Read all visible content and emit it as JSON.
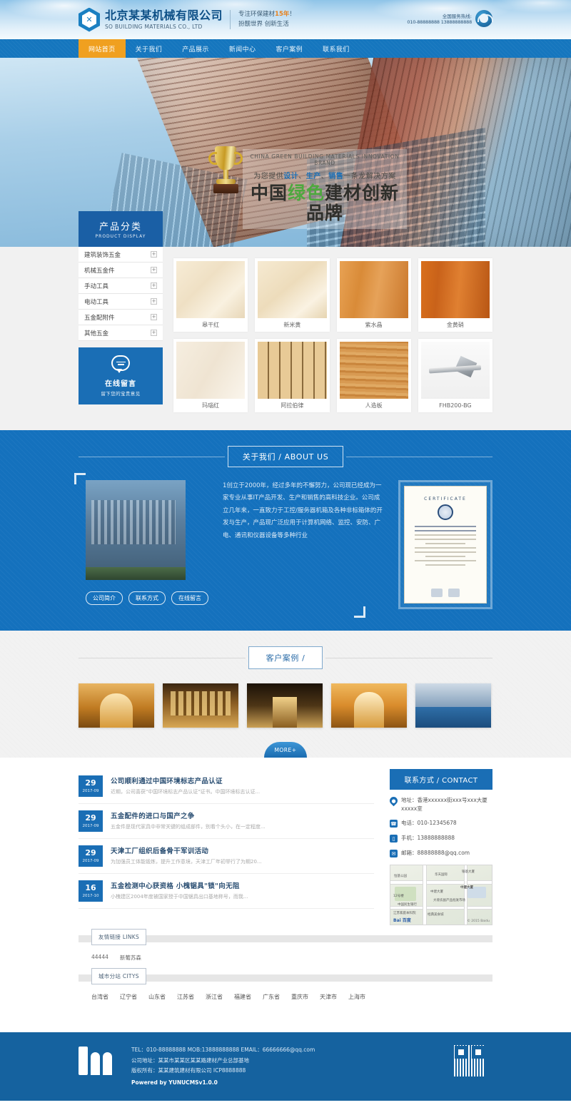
{
  "header": {
    "logo_cn": "北京某某机械有限公司",
    "logo_en": "SO BUILDING MATERIALS CO., LTD",
    "logo_glyph": "✕",
    "slogan_line1_pre": "专注环保建材",
    "slogan_line1_hl": "15年",
    "slogan_line1_post": "！",
    "slogan_line2": "扮靓世界 创新生活",
    "hotline_label": "全国服务热线:",
    "hotline_number": "010-88888888 13888888888"
  },
  "nav": {
    "items": [
      {
        "label": "网站首页",
        "active": true
      },
      {
        "label": "关于我们",
        "active": false
      },
      {
        "label": "产品展示",
        "active": false
      },
      {
        "label": "新闻中心",
        "active": false
      },
      {
        "label": "客户案例",
        "active": false
      },
      {
        "label": "联系我们",
        "active": false
      }
    ]
  },
  "banner": {
    "english": "CHINA GREEN BUILDING MATERIALS INNOVATION BRAND",
    "subtitle_a": "为您提供",
    "subtitle_b": "设计",
    "subtitle_c": "、",
    "subtitle_d": "生产",
    "subtitle_e": "、",
    "subtitle_f": "销售",
    "subtitle_g": "一条龙解决方案",
    "title_pre": "中国",
    "title_green": "绿色",
    "title_post": "建材创新品牌"
  },
  "products": {
    "panel_title_cn": "产品分类",
    "panel_title_en": "PRODUCT DISPLAY",
    "categories": [
      {
        "label": "建筑装饰五金",
        "expand": "+"
      },
      {
        "label": "机械五金件",
        "expand": "+"
      },
      {
        "label": "手动工具",
        "expand": "+"
      },
      {
        "label": "电动工具",
        "expand": "+"
      },
      {
        "label": "五金配附件",
        "expand": "+"
      },
      {
        "label": "其他五金",
        "expand": "+"
      }
    ],
    "message_box": {
      "title": "在线留言",
      "subtitle": "留下您的宝贵意见"
    },
    "items": [
      {
        "name": "皋干红",
        "swatch": "sw-cream"
      },
      {
        "name": "新米黄",
        "swatch": "sw-beige"
      },
      {
        "name": "紫水晶",
        "swatch": "sw-wood1"
      },
      {
        "name": "金黄硝",
        "swatch": "sw-wood2"
      },
      {
        "name": "玛瑙红",
        "swatch": "sw-light"
      },
      {
        "name": "阿拉伯律",
        "swatch": "sw-slat"
      },
      {
        "name": "人造板",
        "swatch": "sw-oak"
      },
      {
        "name": "FHB200-BG",
        "swatch": "sw-tool"
      }
    ]
  },
  "about": {
    "section_title": "关于我们 / ABOUT US",
    "body": "1创立于2000年，经过多年的不懈努力，公司现已经成为一家专业从事IT产品开发、生产和销售的高科技企业。公司成立几年来，一直致力于工控/服务器机箱及各种非标箱体的开发与生产，产品现广泛应用于计算机网络、监控、安防、广电、通讯和仪器设备等多种行业",
    "buttons": [
      "公司简介",
      "联系方式",
      "在线留言"
    ],
    "certificate": {
      "heading": "CERTIFICATE",
      "badge": "ESC"
    }
  },
  "cases": {
    "section_title": "客户案例 /",
    "more_label": "MORE+",
    "items": [
      {
        "cls": "c1"
      },
      {
        "cls": "c2"
      },
      {
        "cls": "c3"
      },
      {
        "cls": "c4"
      },
      {
        "cls": "c5"
      }
    ]
  },
  "news": {
    "items": [
      {
        "day": "29",
        "month": "2017-09",
        "title": "公司顺利通过中国环境标志产品认证",
        "desc": "近期，公司喜获\"中国环境标志产品认证\"证书。中国环境标志认证..."
      },
      {
        "day": "29",
        "month": "2017-09",
        "title": "五金配件的进口与国产之争",
        "desc": "五金件是现代家具中非常关键的组成部件，别看个头小，在一定程度..."
      },
      {
        "day": "29",
        "month": "2017-09",
        "title": "天津工厂组织后备骨干军训活动",
        "desc": "为加强员工体能锻炼，提升工作意境，天津工厂年初举行了为期20..."
      },
      {
        "day": "16",
        "month": "2017-10",
        "title": "五金检测中心获资格 小槐锯具\"锁\"向无阻",
        "desc": "小槐建区2004年度被国家授于中国锯具出口基地称号，而我..."
      }
    ]
  },
  "contact": {
    "heading": "联系方式 / CONTACT",
    "lines": [
      {
        "icon": "location-pin",
        "glyph": "●",
        "text": "地址：香港xxxxxx街xxx号xxx大厦xxxxx室"
      },
      {
        "icon": "telephone",
        "glyph": "☎",
        "text": "电话：010-12345678"
      },
      {
        "icon": "mobile-phone",
        "glyph": "▯",
        "text": "手机：13888888888"
      },
      {
        "icon": "envelope",
        "glyph": "✉",
        "text": "邮箱：88888888@qq.com"
      }
    ],
    "map": {
      "labels": [
        "恒基公园",
        "华天国际",
        "中建大厦",
        "12号楼",
        "中国民生银行",
        "中建大厦",
        "江苏家庭本科院",
        "大境农副产品批发市场",
        "经典美食城",
        "银基大厦",
        "银基大厦"
      ],
      "brand": "Bai 百度",
      "copyright": "© 2015 Baidu"
    }
  },
  "links": {
    "heading": "友情链接 LINKS",
    "items": [
      "44444",
      "新葡苏森"
    ],
    "city_heading": "城市分站 CITYS",
    "cities": [
      "台湾省",
      "辽宁省",
      "山东省",
      "江苏省",
      "浙江省",
      "福建省",
      "广东省",
      "重庆市",
      "天津市",
      "上海市"
    ]
  },
  "footer": {
    "line1": "TEL：010-88888888 MOB:13888888888 EMAIL：66666666@qq.com",
    "line2": "公司地址：某某市某某区某某路建材产业总部基地",
    "line3": "版权所有：某某建筑建材有限公司 ICP8888888",
    "powered": "Powered by YUNUCMSv1.0.0"
  },
  "colors": {
    "brand_blue": "#1576be",
    "accent_orange": "#f0a020",
    "deep_blue": "#1a5fa5",
    "footer_blue": "#15629f",
    "green": "#4ea83f"
  }
}
